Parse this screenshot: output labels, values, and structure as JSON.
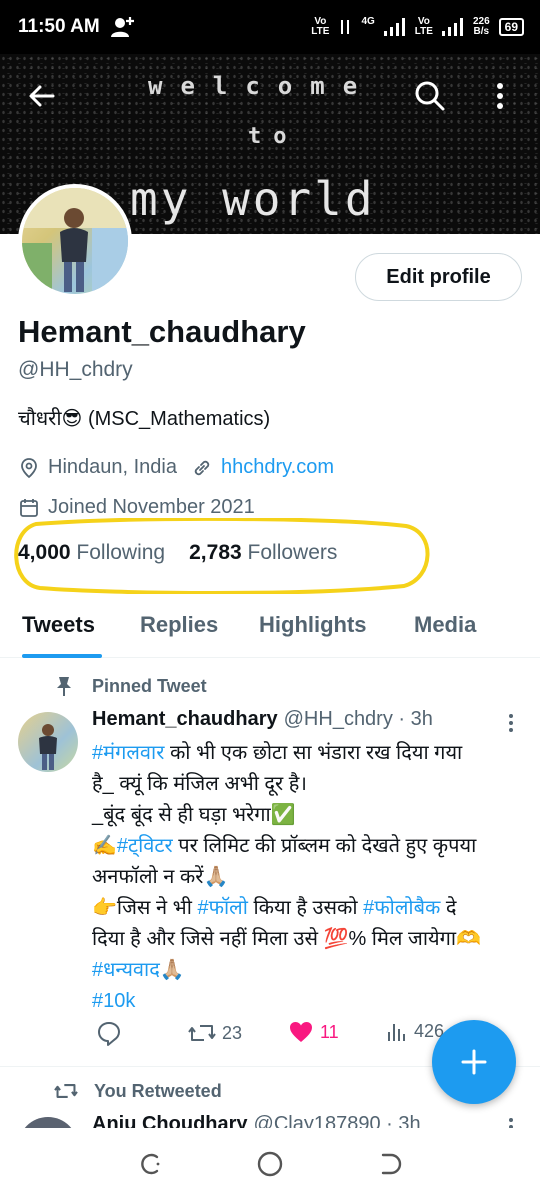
{
  "status_bar": {
    "time": "11:50 AM",
    "volte1": [
      "Vo",
      "LTE"
    ],
    "net_label": "4G",
    "volte2": [
      "Vo",
      "LTE"
    ],
    "speed": [
      "226",
      "B/s"
    ],
    "battery": "69"
  },
  "banner": {
    "line1": "welcome",
    "line2": "to",
    "line3": "my world"
  },
  "profile": {
    "edit_button": "Edit profile",
    "name": "Hemant_chaudhary",
    "handle": "@HH_chdry",
    "bio": "चौधरी😎 (MSC_Mathematics)",
    "location": "Hindaun, India",
    "website": "hhchdry.com",
    "joined": "Joined November 2021",
    "following_count": "4,000",
    "following_label": "Following",
    "followers_count": "2,783",
    "followers_label": "Followers"
  },
  "tabs": [
    "Tweets",
    "Replies",
    "Highlights",
    "Media"
  ],
  "pinned_tweet": {
    "label": "Pinned Tweet",
    "name": "Hemant_chaudhary",
    "handle_time": "@HH_chdry · 3h",
    "body": {
      "l1_tag": "#मंगलवार",
      "l1_text": " को भी एक छोटा सा भंडारा रख दिया गया",
      "l2": "है_ क्यूं कि मंजिल अभी दूर है।",
      "l3": "_बूंद बूंद से ही घड़ा भरेगा✅",
      "l4_pre": "✍️",
      "l4_tag": "#ट्विटर",
      "l4_text": " पर लिमिट की प्रॉब्लम को देखते हुए कृपया",
      "l5": "अनफॉलो न करें🙏🏼",
      "l6_pre": "👉जिस ने भी ",
      "l6_tag1": "#फॉलो",
      "l6_mid": " किया है उसको ",
      "l6_tag2": "#फोलोबैक",
      "l6_end": " दे",
      "l7": "दिया है और जिसे नहीं मिला उसे 💯% मिल जायेगा🫶",
      "l8_tag": "#धन्यवाद",
      "l8_end": "🙏🏼",
      "l9_tag": "#10k"
    },
    "retweets": "23",
    "likes": "11",
    "views": "426"
  },
  "next_tweet": {
    "label": "You Retweeted",
    "name": "Anju Choudhary",
    "handle_time": "@Clay187890 · 3h"
  },
  "colors": {
    "accent": "#1d9bf0",
    "like": "#f91880",
    "highlight": "#f5d21a"
  }
}
